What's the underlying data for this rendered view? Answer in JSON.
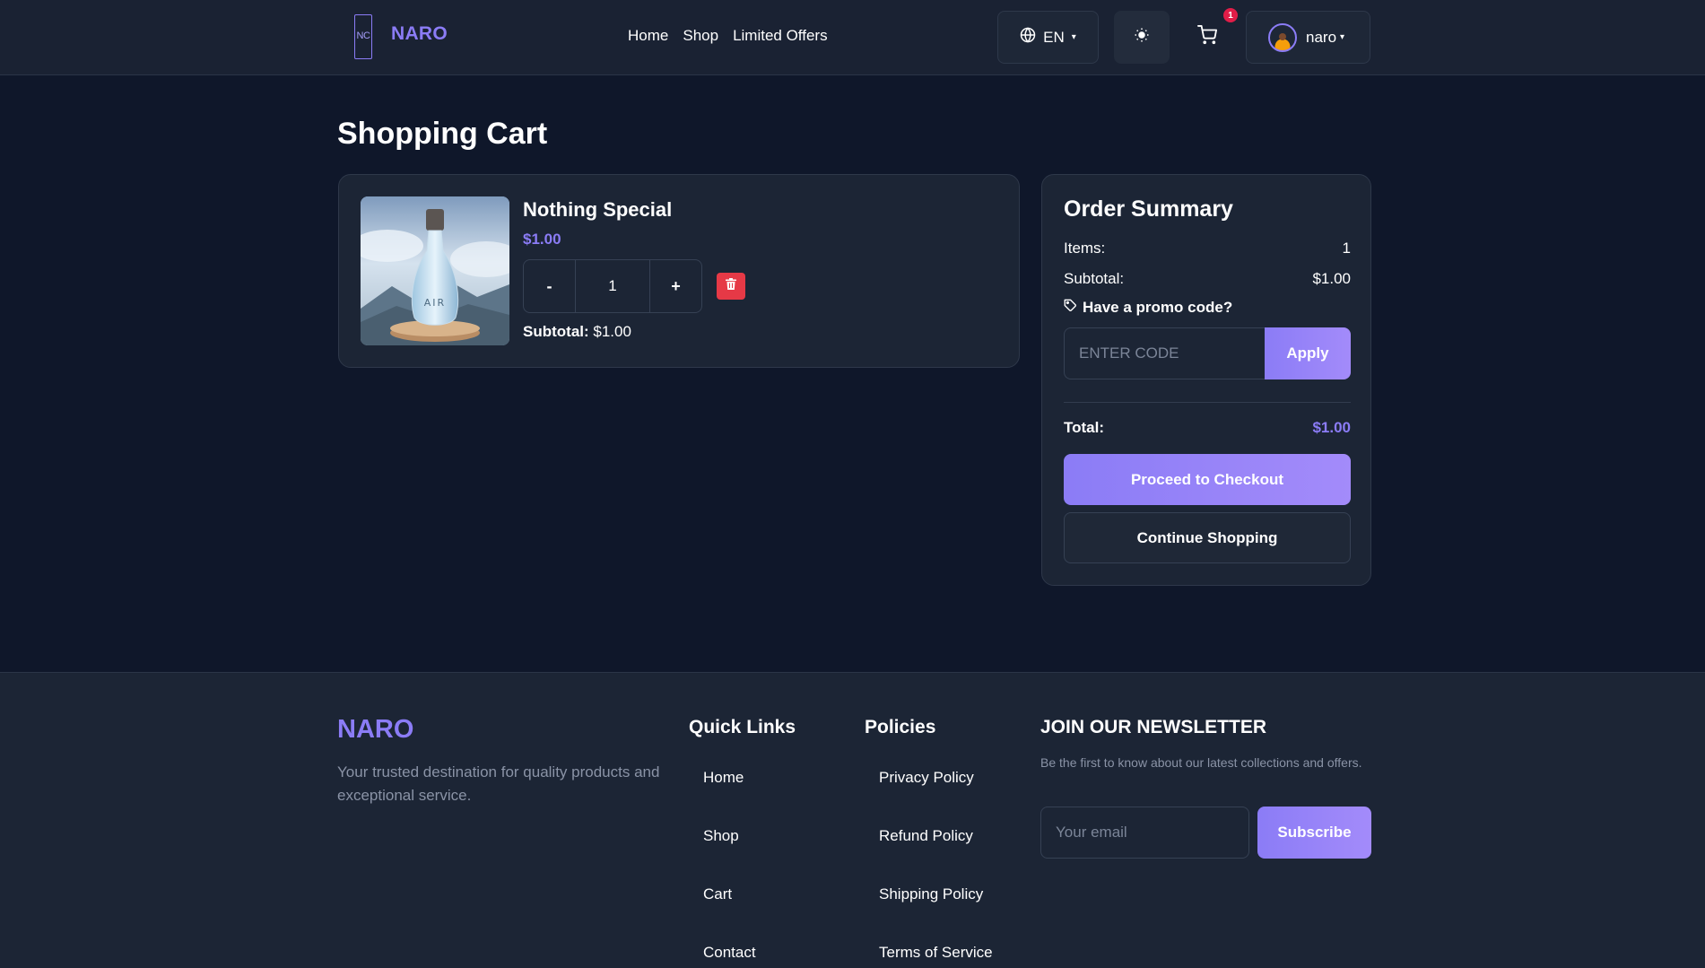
{
  "header": {
    "logo_mark": "NC",
    "brand": "NARO",
    "nav": [
      {
        "label": "Home"
      },
      {
        "label": "Shop"
      },
      {
        "label": "Limited Offers"
      }
    ],
    "language": "EN",
    "cart_count": "1",
    "username": "naro"
  },
  "page": {
    "title": "Shopping Cart"
  },
  "cart": {
    "items": [
      {
        "name": "Nothing Special",
        "price": "$1.00",
        "quantity": "1",
        "minus_label": "-",
        "plus_label": "+",
        "subtotal_label": "Subtotal:",
        "subtotal_value": "$1.00",
        "image_text": "AIR"
      }
    ]
  },
  "summary": {
    "title": "Order Summary",
    "items_label": "Items:",
    "items_value": "1",
    "subtotal_label": "Subtotal:",
    "subtotal_value": "$1.00",
    "promo_label": "Have a promo code?",
    "promo_placeholder": "ENTER CODE",
    "apply_label": "Apply",
    "total_label": "Total:",
    "total_value": "$1.00",
    "checkout_label": "Proceed to Checkout",
    "continue_label": "Continue Shopping"
  },
  "footer": {
    "brand": "NARO",
    "description": "Your trusted destination for quality products and exceptional service.",
    "quick_links_title": "Quick Links",
    "quick_links": [
      "Home",
      "Shop",
      "Cart",
      "Contact"
    ],
    "policies_title": "Policies",
    "policies": [
      "Privacy Policy",
      "Refund Policy",
      "Shipping Policy",
      "Terms of Service"
    ],
    "newsletter_title": "JOIN OUR NEWSLETTER",
    "newsletter_desc": "Be the first to know about our latest collections and offers.",
    "email_placeholder": "Your email",
    "subscribe_label": "Subscribe"
  },
  "colors": {
    "accent": "#8b7cf6",
    "background": "#0f172a",
    "card": "#1c2535",
    "danger": "#e63946"
  },
  "icons": [
    "globe-icon",
    "sun-icon",
    "cart-icon",
    "trash-icon",
    "tag-icon",
    "chevron-down-icon"
  ]
}
